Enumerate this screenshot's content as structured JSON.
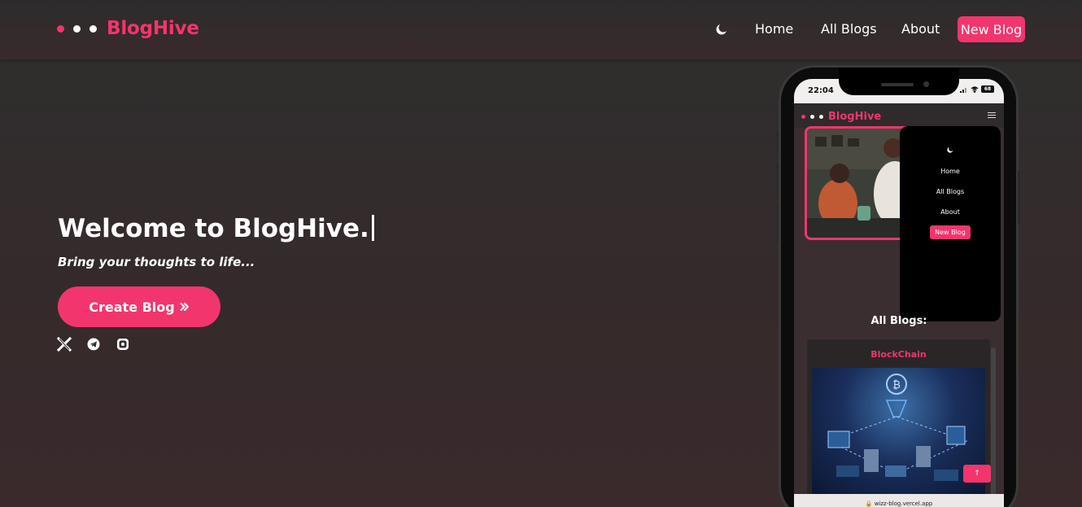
{
  "brand": {
    "name": "BlogHive",
    "accent": "#f2356d"
  },
  "nav": {
    "theme_icon": "moon-icon",
    "home": "Home",
    "all_blogs": "All Blogs",
    "about": "About",
    "new_blog": "New Blog"
  },
  "hero": {
    "title": "Welcome to BlogHive.",
    "subtitle": "Bring your thoughts to life...",
    "cta_label": "Create Blog",
    "cta_icon": "double-chevron-right-icon",
    "socials": [
      "x-icon",
      "telegram-icon",
      "instagram-icon"
    ]
  },
  "mockup": {
    "status_time": "22:04",
    "battery": "68",
    "brand": "BlogHive",
    "menu": {
      "home": "Home",
      "all_blogs": "All Blogs",
      "about": "About",
      "new_blog": "New Blog"
    },
    "section_title": "All Blogs:",
    "card_title": "BlockChain",
    "scroll_up_label": "↑",
    "url": "wizz-blog.vercel.app"
  }
}
